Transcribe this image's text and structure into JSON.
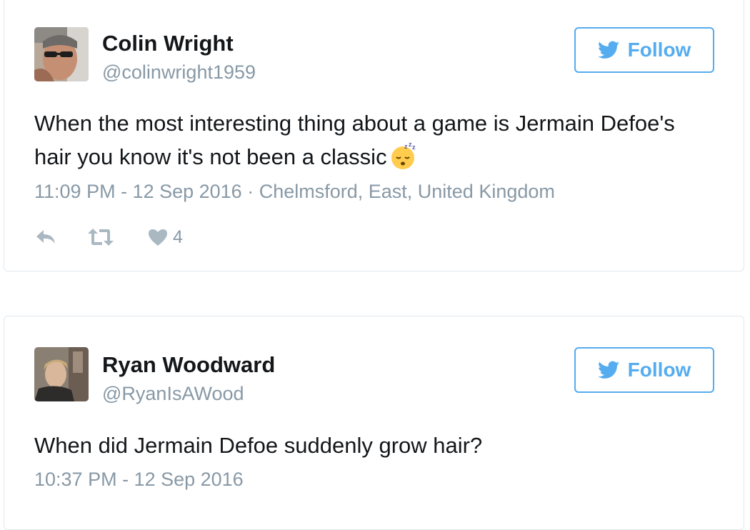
{
  "tweets": [
    {
      "name": "Colin Wright",
      "handle": "@colinwright1959",
      "follow_label": "Follow",
      "text": "When the most interesting thing about a game is Jermain Defoe's hair you know it's not been a classic",
      "emoji": "sleeping-face-emoji",
      "time": "11:09 PM - 12 Sep 2016",
      "location": "Chelmsford, East, United Kingdom",
      "likes": "4"
    },
    {
      "name": "Ryan Woodward",
      "handle": "@RyanIsAWood",
      "follow_label": "Follow",
      "text": "When did Jermain Defoe suddenly grow hair?",
      "time": "10:37 PM - 12 Sep 2016"
    }
  ],
  "colors": {
    "twitter_blue": "#55acee",
    "meta_gray": "#8899a6",
    "text": "#14171a",
    "border": "#e1e8ed"
  },
  "icons": [
    "twitter-bird-icon",
    "reply-icon",
    "retweet-icon",
    "heart-icon"
  ]
}
